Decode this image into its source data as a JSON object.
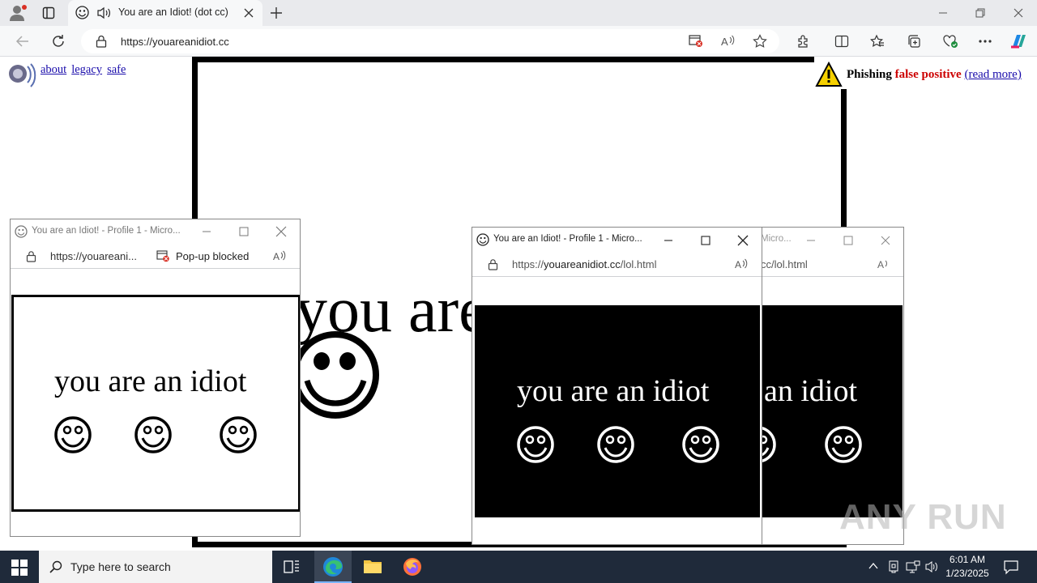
{
  "browser": {
    "tab_title": "You are an Idiot! (dot cc)",
    "url": "https://youareanidiot.cc"
  },
  "page": {
    "links": [
      "about",
      "legacy",
      "safe"
    ],
    "big_text": "you are an idiot",
    "phishing": {
      "label": "Phishing",
      "highlight": "false positive",
      "link": "(read more)"
    }
  },
  "popups": [
    {
      "title": "You are an Idiot! - Profile 1 - Micro...",
      "url": "https://youareani...",
      "popup_blocked": "Pop-up blocked",
      "text": "you are an idiot",
      "theme": "light"
    },
    {
      "title": "You are an Idiot! - Profile 1 - Micro...",
      "url_prefix": "https://",
      "url_domain": "youareanidiot.cc",
      "url_path": "/lol.html",
      "text": "you are an idiot",
      "theme": "dark"
    },
    {
      "title": "Micro...",
      "url": "cc/lol.html",
      "text": "an idiot",
      "theme": "dark"
    }
  ],
  "taskbar": {
    "search_placeholder": "Type here to search",
    "time": "6:01 AM",
    "date": "1/23/2025"
  },
  "watermark": "ANY RUN",
  "colors": {
    "tabbar": "#e9eaed",
    "taskbar": "#1f2a3a",
    "link": "#1a0dab",
    "warning": "#cc0000"
  }
}
